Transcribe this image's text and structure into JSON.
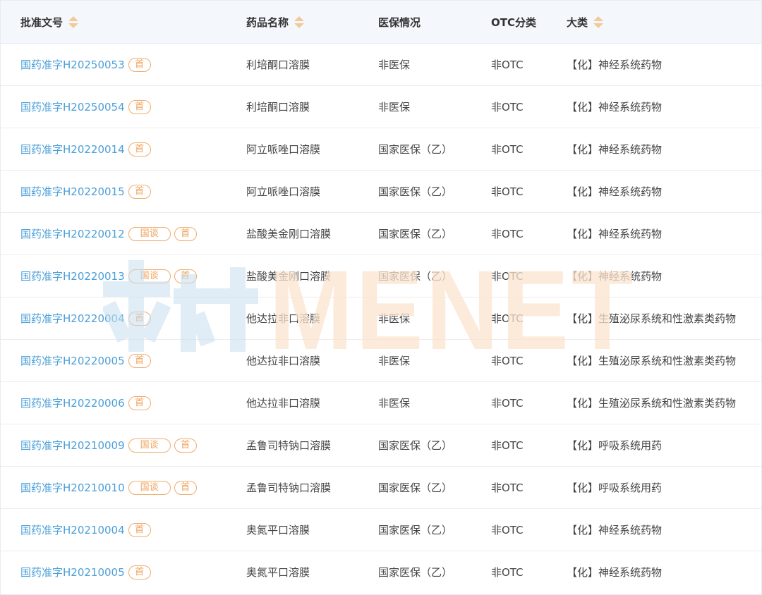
{
  "header": {
    "approval_no": "批准文号",
    "drug_name": "药品名称",
    "insurance": "医保情况",
    "otc": "OTC分类",
    "category": "大类"
  },
  "watermark": {
    "text": "MENET",
    "colors": {
      "blue": "#c8dff0",
      "orange": "#fbe3cf"
    }
  },
  "colors": {
    "link": "#4a9fd8",
    "badge": "#f0a25c",
    "sort_arrow": "#f3c99a",
    "header_bg": "#f4f7fb"
  },
  "rows": [
    {
      "approval_no": "国药准字H20250053",
      "badges": [
        "首"
      ],
      "drug_name": "利培酮口溶膜",
      "insurance": "非医保",
      "otc": "非OTC",
      "category": "【化】神经系统药物"
    },
    {
      "approval_no": "国药准字H20250054",
      "badges": [
        "首"
      ],
      "drug_name": "利培酮口溶膜",
      "insurance": "非医保",
      "otc": "非OTC",
      "category": "【化】神经系统药物"
    },
    {
      "approval_no": "国药准字H20220014",
      "badges": [
        "首"
      ],
      "drug_name": "阿立哌唑口溶膜",
      "insurance": "国家医保（乙）",
      "otc": "非OTC",
      "category": "【化】神经系统药物"
    },
    {
      "approval_no": "国药准字H20220015",
      "badges": [
        "首"
      ],
      "drug_name": "阿立哌唑口溶膜",
      "insurance": "国家医保（乙）",
      "otc": "非OTC",
      "category": "【化】神经系统药物"
    },
    {
      "approval_no": "国药准字H20220012",
      "badges": [
        "国谈",
        "首"
      ],
      "drug_name": "盐酸美金刚口溶膜",
      "insurance": "国家医保（乙）",
      "otc": "非OTC",
      "category": "【化】神经系统药物"
    },
    {
      "approval_no": "国药准字H20220013",
      "badges": [
        "国谈",
        "首"
      ],
      "drug_name": "盐酸美金刚口溶膜",
      "insurance": "国家医保（乙）",
      "otc": "非OTC",
      "category": "【化】神经系统药物"
    },
    {
      "approval_no": "国药准字H20220004",
      "badges": [
        "首"
      ],
      "drug_name": "他达拉非口溶膜",
      "insurance": "非医保",
      "otc": "非OTC",
      "category": "【化】生殖泌尿系统和性激素类药物"
    },
    {
      "approval_no": "国药准字H20220005",
      "badges": [
        "首"
      ],
      "drug_name": "他达拉非口溶膜",
      "insurance": "非医保",
      "otc": "非OTC",
      "category": "【化】生殖泌尿系统和性激素类药物"
    },
    {
      "approval_no": "国药准字H20220006",
      "badges": [
        "首"
      ],
      "drug_name": "他达拉非口溶膜",
      "insurance": "非医保",
      "otc": "非OTC",
      "category": "【化】生殖泌尿系统和性激素类药物"
    },
    {
      "approval_no": "国药准字H20210009",
      "badges": [
        "国谈",
        "首"
      ],
      "drug_name": "孟鲁司特钠口溶膜",
      "insurance": "国家医保（乙）",
      "otc": "非OTC",
      "category": "【化】呼吸系统用药"
    },
    {
      "approval_no": "国药准字H20210010",
      "badges": [
        "国谈",
        "首"
      ],
      "drug_name": "孟鲁司特钠口溶膜",
      "insurance": "国家医保（乙）",
      "otc": "非OTC",
      "category": "【化】呼吸系统用药"
    },
    {
      "approval_no": "国药准字H20210004",
      "badges": [
        "首"
      ],
      "drug_name": "奥氮平口溶膜",
      "insurance": "国家医保（乙）",
      "otc": "非OTC",
      "category": "【化】神经系统药物"
    },
    {
      "approval_no": "国药准字H20210005",
      "badges": [
        "首"
      ],
      "drug_name": "奥氮平口溶膜",
      "insurance": "国家医保（乙）",
      "otc": "非OTC",
      "category": "【化】神经系统药物"
    }
  ]
}
